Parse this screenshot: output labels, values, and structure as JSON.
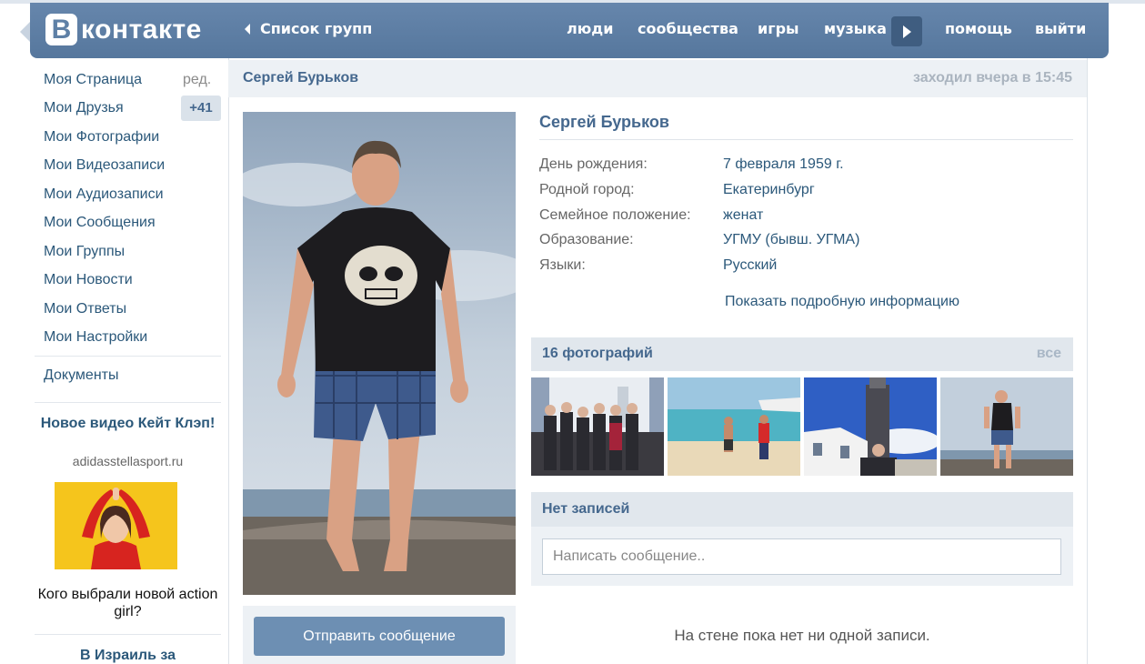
{
  "header": {
    "logo_letter": "В",
    "logo_text": "контакте",
    "back_label": "Список групп",
    "nav": [
      "люди",
      "сообщества",
      "игры",
      "музыка",
      "помощь",
      "выйти"
    ]
  },
  "sidebar": {
    "items": [
      {
        "label": "Моя Страница"
      },
      {
        "label": "Мои Друзья"
      },
      {
        "label": "Мои Фотографии"
      },
      {
        "label": "Мои Видеозаписи"
      },
      {
        "label": "Мои Аудиозаписи"
      },
      {
        "label": "Мои Сообщения"
      },
      {
        "label": "Мои Группы"
      },
      {
        "label": "Мои Новости"
      },
      {
        "label": "Мои Ответы"
      },
      {
        "label": "Мои Настройки"
      }
    ],
    "edit_label": "ред.",
    "friends_badge": "+41",
    "documents": "Документы",
    "ad": {
      "title": "Новое видео Кейт Клэп!",
      "domain": "adidasstellasport.ru",
      "caption": "Кого выбрали новой action girl?",
      "next_title": "В Израиль за"
    }
  },
  "profile": {
    "name": "Сергей Бурьков",
    "last_seen": "заходил вчера в 15:45",
    "info": [
      {
        "label": "День рождения:",
        "value": "7 февраля 1959 г."
      },
      {
        "label": "Родной город:",
        "value": "Екатеринбург"
      },
      {
        "label": "Семейное положение:",
        "value": "женат"
      },
      {
        "label": "Образование:",
        "value": "УГМУ (бывш. УГМА)"
      },
      {
        "label": "Языки:",
        "value": "Русский"
      }
    ],
    "more_info": "Показать подробную информацию",
    "send_message": "Отправить сообщение"
  },
  "photos": {
    "title": "16 фотографий",
    "all_label": "все"
  },
  "wall": {
    "title": "Нет записей",
    "placeholder": "Написать сообщение..",
    "empty_text": "На стене пока нет ни одной записи."
  }
}
